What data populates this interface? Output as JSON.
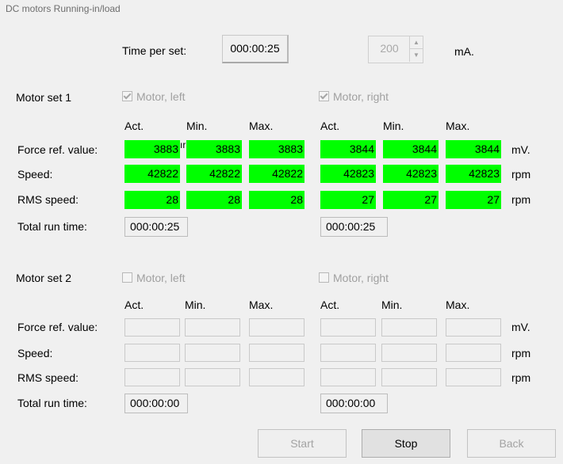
{
  "window": {
    "title": "DC motors Running-in/load"
  },
  "top": {
    "time_label": "Time per set:",
    "time_value": "000:00:25",
    "current_value": "200",
    "current_unit": "mA."
  },
  "headers": {
    "act": "Act.",
    "min": "Min.",
    "max": "Max."
  },
  "rows": {
    "force": "Force ref. value:",
    "speed": "Speed:",
    "rms": "RMS speed:",
    "total": "Total run time:"
  },
  "units": {
    "force": "mV.",
    "speed": "rpm",
    "rms": "rpm"
  },
  "set1": {
    "label": "Motor set 1",
    "left_label": "Motor, left",
    "right_label": "Motor, right",
    "left_checked": true,
    "right_checked": true,
    "left": {
      "force": [
        "3883",
        "3883",
        "3883"
      ],
      "speed": [
        "42822",
        "42822",
        "42822"
      ],
      "rms": [
        "28",
        "28",
        "28"
      ],
      "total": "000:00:25"
    },
    "right": {
      "force": [
        "3844",
        "3844",
        "3844"
      ],
      "speed": [
        "42823",
        "42823",
        "42823"
      ],
      "rms": [
        "27",
        "27",
        "27"
      ],
      "total": "000:00:25"
    },
    "overlap_text": "ır"
  },
  "set2": {
    "label": "Motor set 2",
    "left_label": "Motor, left",
    "right_label": "Motor, right",
    "left_checked": false,
    "right_checked": false,
    "left_total": "000:00:00",
    "right_total": "000:00:00"
  },
  "buttons": {
    "start": "Start",
    "stop": "Stop",
    "back": "Back"
  },
  "colors": {
    "active_cell": "#00ff00",
    "background": "#f0f0f0",
    "disabled_text": "#a0a0a0"
  }
}
